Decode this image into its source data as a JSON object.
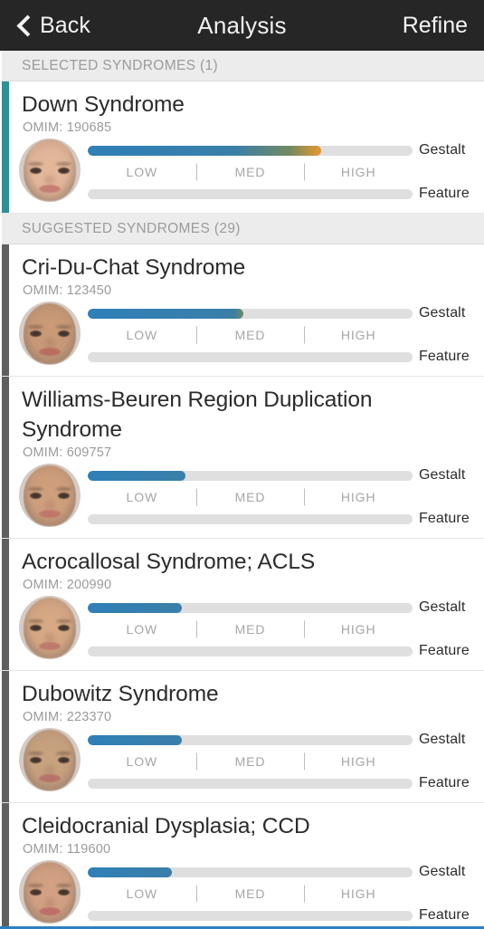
{
  "navbar": {
    "back_label": "Back",
    "title": "Analysis",
    "refine_label": "Refine",
    "back_icon": "chevron-left-icon",
    "background_color": "#262626"
  },
  "meter_scale": {
    "low": "LOW",
    "med": "MED",
    "high": "HIGH"
  },
  "meter_labels": {
    "gestalt": "Gestalt",
    "feature": "Feature"
  },
  "colors": {
    "selected_strip": "#2f9096",
    "suggested_strip": "#5f5f5f",
    "bar_track": "#dfdfdf",
    "bar_low": "#2f7fb8",
    "bar_mid": "#6f8a63",
    "bar_high": "#e8982e",
    "section_header_bg": "#ececec",
    "bottom_bar": "#2f7fc4"
  },
  "sections": [
    {
      "header": "SELECTED SYNDROMES (1)",
      "count": 1,
      "selected": true,
      "cards": [
        {
          "title": "Down Syndrome",
          "omim": "OMIM: 190685",
          "avatar": "down-syndrome-composite-face",
          "gestalt_percent": 72,
          "feature_percent": 0,
          "gestalt_level": "HIGH",
          "strip_color": "#2f9096",
          "skin": "#e3b79a",
          "mouth": "#c87f73"
        }
      ]
    },
    {
      "header": "SUGGESTED SYNDROMES (29)",
      "count": 29,
      "selected": false,
      "cards": [
        {
          "title": "Cri-Du-Chat Syndrome",
          "omim": "OMIM: 123450",
          "avatar": "cri-du-chat-composite-face",
          "gestalt_percent": 48,
          "feature_percent": 0,
          "gestalt_level": "MED",
          "strip_color": "#5f5f5f",
          "skin": "#c99a78",
          "mouth": "#bb6e60"
        },
        {
          "title": "Williams-Beuren Region Duplication Syndrome",
          "omim": "OMIM: 609757",
          "avatar": "williams-beuren-composite-face",
          "gestalt_percent": 30,
          "feature_percent": 0,
          "gestalt_level": "LOW",
          "strip_color": "#5f5f5f",
          "skin": "#cf9f7d",
          "mouth": "#c3786a"
        },
        {
          "title": "Acrocallosal Syndrome; ACLS",
          "omim": "OMIM: 200990",
          "avatar": "acrocallosal-composite-face",
          "gestalt_percent": 29,
          "feature_percent": 0,
          "gestalt_level": "LOW",
          "strip_color": "#5f5f5f",
          "skin": "#d6a884",
          "mouth": "#c07b6c"
        },
        {
          "title": "Dubowitz Syndrome",
          "omim": "OMIM: 223370",
          "avatar": "dubowitz-composite-face",
          "gestalt_percent": 29,
          "feature_percent": 0,
          "gestalt_level": "LOW",
          "strip_color": "#5f5f5f",
          "skin": "#c8a27f",
          "mouth": "#b9746a"
        },
        {
          "title": "Cleidocranial Dysplasia; CCD",
          "omim": "OMIM: 119600",
          "avatar": "cleidocranial-dysplasia-composite-face",
          "gestalt_percent": 26,
          "feature_percent": 0,
          "gestalt_level": "LOW",
          "strip_color": "#5f5f5f",
          "skin": "#d2a183",
          "mouth": "#c0706a"
        }
      ]
    }
  ]
}
